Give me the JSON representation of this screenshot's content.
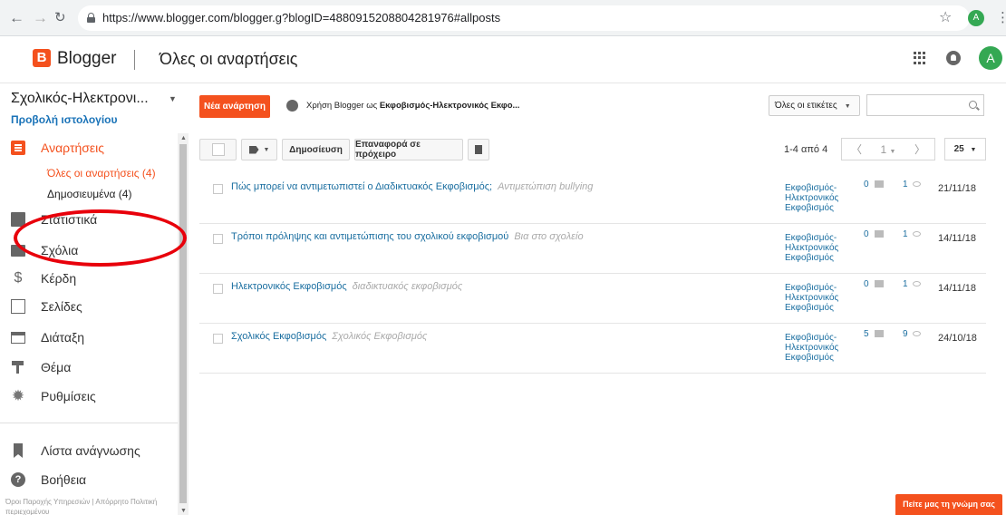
{
  "browser": {
    "url": "https://www.blogger.com/blogger.g?blogID=4880915208804281976#allposts",
    "profile_initial": "A"
  },
  "header": {
    "brand": "Blogger",
    "title": "Όλες οι αναρτήσεις",
    "avatar_initial": "A"
  },
  "sidebar": {
    "blog_name": "Σχολικός-Ηλεκτρονι...",
    "view_blog": "Προβολή ιστολογίου",
    "items": [
      {
        "label": "Αναρτήσεις",
        "icon": "posts-icon"
      },
      {
        "label": "Στατιστικά",
        "icon": "stats-icon"
      },
      {
        "label": "Σχόλια",
        "icon": "comments-icon"
      },
      {
        "label": "Κέρδη",
        "icon": "earnings-icon"
      },
      {
        "label": "Σελίδες",
        "icon": "pages-icon"
      },
      {
        "label": "Διάταξη",
        "icon": "layout-icon"
      },
      {
        "label": "Θέμα",
        "icon": "theme-icon"
      },
      {
        "label": "Ρυθμίσεις",
        "icon": "settings-icon"
      }
    ],
    "sub_items": {
      "all_posts": "Όλες οι αναρτήσεις (4)",
      "published": "Δημοσιευμένα (4)"
    },
    "bottom_items": [
      {
        "label": "Λίστα ανάγνωσης",
        "icon": "bookmark-icon"
      },
      {
        "label": "Βοήθεια",
        "icon": "help-icon"
      }
    ],
    "footer": "Όροι Παροχής Υπηρεσιών | Απόρρητο Πολιτική περιεχομένου",
    "accent": "#f4511e"
  },
  "toolbar": {
    "new_post": "Νέα ανάρτηση",
    "using_as_prefix": "Χρήση Blogger ως ",
    "using_as_name": "Εκφοβισμός-Ηλεκτρονικός Εκφο...",
    "labels_dropdown": "Όλες οι ετικέτες",
    "search_placeholder": "",
    "publish": "Δημοσίευση",
    "revert": "Επαναφορά σε πρόχειρο",
    "count": "1-4 από 4",
    "page": "1",
    "per_page": "25"
  },
  "posts": [
    {
      "title": "Πώς μπορεί να αντιμετωπιστεί ο Διαδικτυακός Εκφοβισμός;",
      "label": "Αντιμετώπιση bullying",
      "tags": "Εκφοβισμός-Ηλεκτρονικός Εκφοβισμός",
      "comments": "0",
      "views": "1",
      "date": "21/11/18"
    },
    {
      "title": "Τρόποι πρόληψης και αντιμετώπισης του σχολικού εκφοβισμού",
      "label": "Βια στο σχολείο",
      "tags": "Εκφοβισμός-Ηλεκτρονικός Εκφοβισμός",
      "comments": "0",
      "views": "1",
      "date": "14/11/18"
    },
    {
      "title": "Ηλεκτρονικός Εκφοβισμός",
      "label": "διαδικτυακός εκφοβισμός",
      "tags": "Εκφοβισμός-Ηλεκτρονικός Εκφοβισμός",
      "comments": "0",
      "views": "1",
      "date": "14/11/18"
    },
    {
      "title": "Σχολικός Εκφοβισμός",
      "label": "Σχολικός Εκφοβισμός",
      "tags": "Εκφοβισμός-Ηλεκτρονικός Εκφοβισμός",
      "comments": "5",
      "views": "9",
      "date": "24/10/18"
    }
  ],
  "feedback": "Πείτε μας τη γνώμη σας",
  "annotation_color": "#e8000b"
}
